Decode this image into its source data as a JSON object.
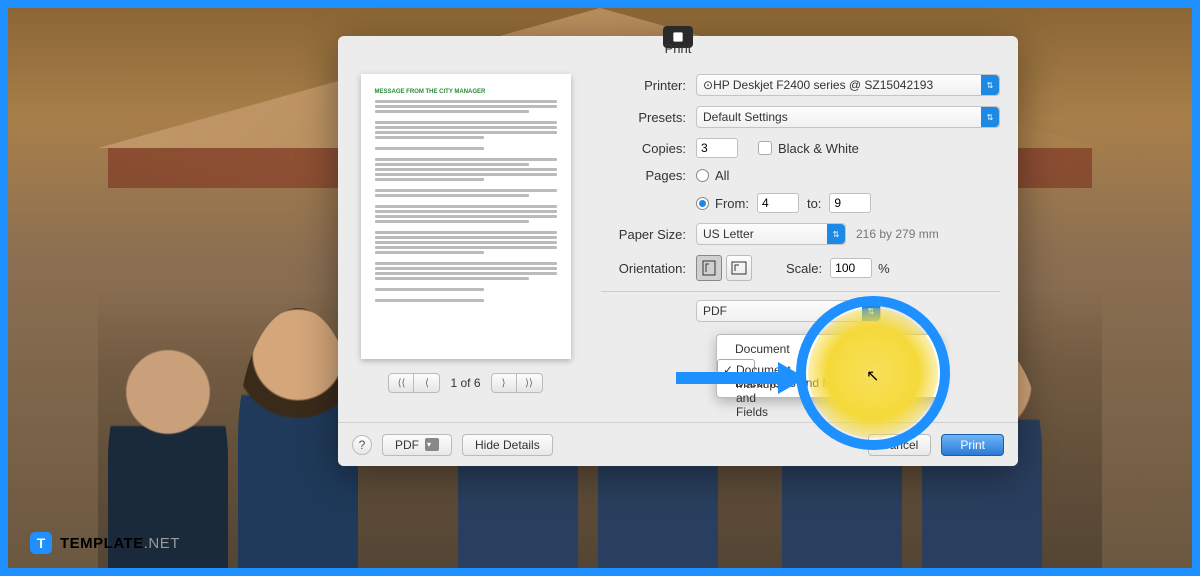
{
  "dialog": {
    "title": "Print",
    "printer_label": "Printer:",
    "printer_value": "HP Deskjet F2400 series @ SZ15042193",
    "presets_label": "Presets:",
    "presets_value": "Default Settings",
    "copies_label": "Copies:",
    "copies_value": "3",
    "bw_label": "Black & White",
    "pages_label": "Pages:",
    "pages_all": "All",
    "pages_from_label": "From:",
    "pages_from": "4",
    "pages_to_label": "to:",
    "pages_to": "9",
    "papersize_label": "Paper Size:",
    "papersize_value": "US Letter",
    "papersize_dim": "216 by 279 mm",
    "orientation_label": "Orientation:",
    "scale_label": "Scale:",
    "scale_value": "100",
    "scale_pct": "%",
    "pdf_section": "PDF",
    "preview_title": "MESSAGE FROM THE CITY MANAGER",
    "page_indicator": "1 of 6",
    "menu": {
      "opt1": "Document",
      "opt2": "Document, Markups and Fields",
      "opt3": "Documents and Markups"
    },
    "footer": {
      "pdf": "PDF",
      "hide": "Hide Details",
      "cancel": "Cancel",
      "print": "Print"
    }
  },
  "watermark": {
    "brand": "TEMPLATE",
    "suffix": ".NET"
  }
}
